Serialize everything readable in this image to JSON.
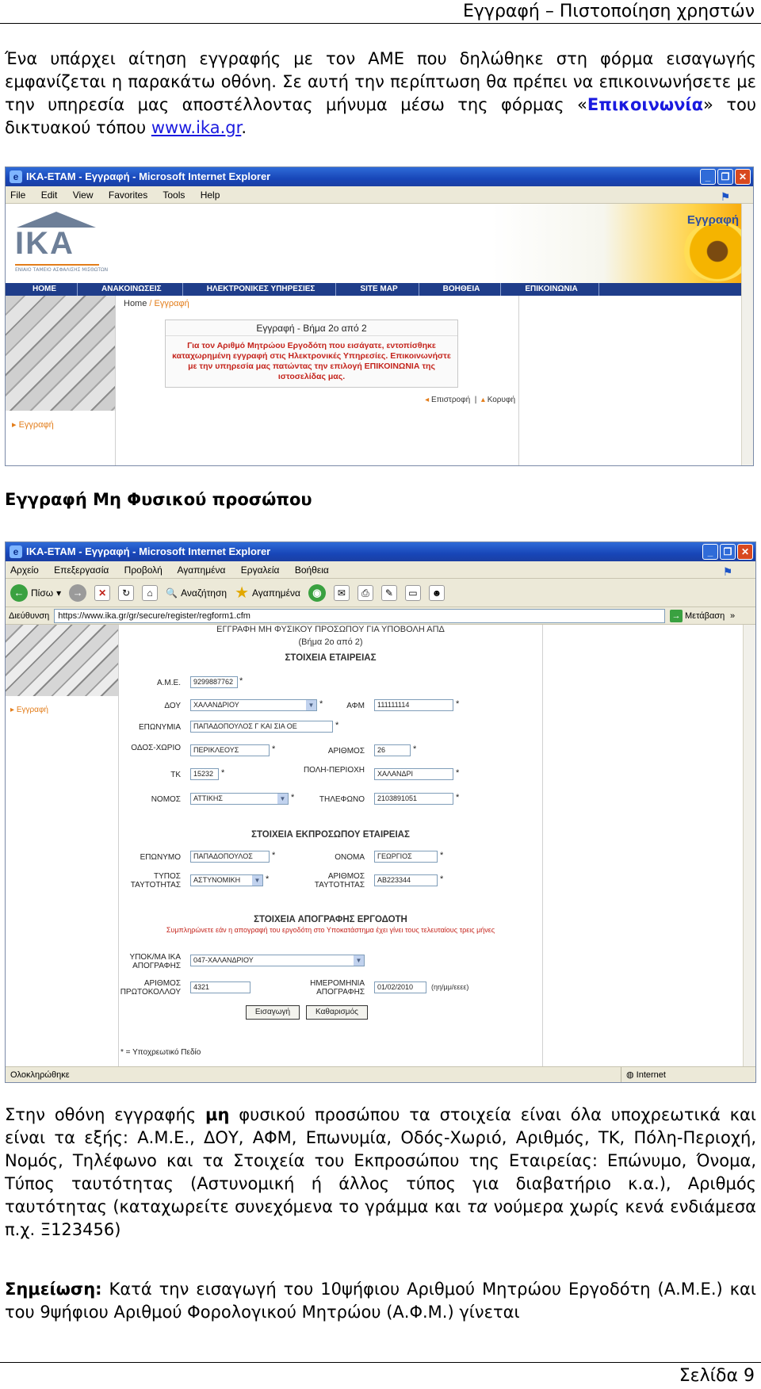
{
  "header": {
    "title": "Εγγραφή – Πιστοποίηση χρηστών"
  },
  "intro": {
    "text1": "Ένα υπάρχει αίτηση εγγραφής με τον ΑΜΕ που δηλώθηκε στη φόρμα εισαγωγής εμφανίζεται η παρακάτω οθόνη. Σε αυτή την περίπτωση θα πρέπει να επικοινωνήσετε με την υπηρεσία μας αποστέλλοντας μήνυμα μέσω της φόρμας «",
    "contact_link": "Επικοινωνία",
    "text2": "» του δικτυακού τόπου ",
    "site_link": "www.ika.gr",
    "text3": "."
  },
  "shot1": {
    "window_title": "IKA-ETAM - Εγγραφή - Microsoft Internet Explorer",
    "menu": [
      "File",
      "Edit",
      "View",
      "Favorites",
      "Tools",
      "Help"
    ],
    "logo_text": "IKA",
    "logo_small": "ΕΝΙΑΙΟ ΤΑΜΕΙΟ ΑΣΦΑΛΙΣΗΣ ΜΙΣΘΩΤΩΝ",
    "banner_label": "Εγγραφή",
    "nav": [
      "HOME",
      "ΑΝΑΚΟΙΝΩΣΕΙΣ",
      "ΗΛΕΚΤΡΟΝΙΚΕΣ ΥΠΗΡΕΣΙΕΣ",
      "SITE MAP",
      "ΒΟΗΘΕΙΑ",
      "ΕΠΙΚΟΙΝΩΝΙΑ"
    ],
    "crumb_home": "Home",
    "crumb_sep": "/",
    "crumb_current": "Εγγραφή",
    "step_title": "Εγγραφή - Βήμα 2ο από 2",
    "step_message": "Για τον Αριθμό Μητρώου Εργοδότη που εισάγατε, εντοπίσθηκε καταχωρημένη εγγραφή στις Ηλεκτρονικές Υπηρεσίες. Επικοινωνήστε με την υπηρεσία μας πατώντας την επιλογή ΕΠΙΚΟΙΝΩΝΙΑ της ιστοσελίδας μας.",
    "back_link": "Επιστροφή",
    "top_link": "Κορυφή",
    "side_link": "Εγγραφή"
  },
  "section_heading": "Εγγραφή Μη Φυσικού προσώπου",
  "shot2": {
    "window_title": "IKA-ETAM - Εγγραφή - Microsoft Internet Explorer",
    "menu": [
      "Αρχείο",
      "Επεξεργασία",
      "Προβολή",
      "Αγαπημένα",
      "Εργαλεία",
      "Βοήθεια"
    ],
    "toolbar": {
      "back": "Πίσω",
      "search": "Αναζήτηση",
      "favorites": "Αγαπημένα"
    },
    "address_label": "Διεύθυνση",
    "address": "https://www.ika.gr/gr/secure/register/regform1.cfm",
    "go_label": "Μετάβαση",
    "links_label": "»",
    "side_link": "Εγγραφή",
    "form": {
      "title1": "ΕΓΓΡΑΦΗ ΜΗ ΦΥΣΙΚΟΥ ΠΡΟΣΩΠΟΥ ΓΙΑ ΥΠΟΒΟΛΗ ΑΠΔ",
      "title2": "(Βήμα 2ο από 2)",
      "section_company": "ΣΤΟΙΧΕΙΑ ΕΤΑΙΡΕΙΑΣ",
      "ame_label": "Α.Μ.Ε.",
      "ame_value": "9299887762",
      "doy_label": "ΔΟΥ",
      "doy_value": "ΧΑΛΑΝΔΡΙΟΥ",
      "afm_label": "ΑΦΜ",
      "afm_value": "111111114",
      "name_label": "ΕΠΩΝΥΜΙΑ",
      "name_value": "ΠΑΠΑΔΟΠΟΥΛΟΣ Γ ΚΑΙ ΣΙΑ ΟΕ",
      "street_label": "ΟΔΟΣ-ΧΩΡΙΟ",
      "street_value": "ΠΕΡΙΚΛΕΟΥΣ",
      "number_label": "ΑΡΙΘΜΟΣ",
      "number_value": "26",
      "tk_label": "ΤΚ",
      "tk_value": "15232",
      "city_label": "ΠΟΛΗ-ΠΕΡΙΟΧΗ",
      "city_value": "ΧΑΛΑΝΔΡΙ",
      "nomos_label": "ΝΟΜΟΣ",
      "nomos_value": "ΑΤΤΙΚΗΣ",
      "phone_label": "ΤΗΛΕΦΩΝΟ",
      "phone_value": "2103891051",
      "section_rep": "ΣΤΟΙΧΕΙΑ ΕΚΠΡΟΣΩΠΟΥ ΕΤΑΙΡΕΙΑΣ",
      "surname_label": "ΕΠΩΝΥΜΟ",
      "surname_value": "ΠΑΠΑΔΟΠΟΥΛΟΣ",
      "firstname_label": "ΟΝΟΜΑ",
      "firstname_value": "ΓΕΩΡΓΙΟΣ",
      "idtype_label": "ΤΥΠΟΣ ΤΑΥΤΟΤΗΤΑΣ",
      "idtype_value": "ΑΣΤΥΝΟΜΙΚΗ",
      "idnum_label": "ΑΡΙΘΜΟΣ ΤΑΥΤΟΤΗΤΑΣ",
      "idnum_value": "ΑΒ223344",
      "section_census": "ΣΤΟΙΧΕΙΑ ΑΠΟΓΡΑΦΗΣ ΕΡΓΟΔΟΤΗ",
      "census_note": "Συμπληρώνετε εάν η απογραφή του εργοδότη στο Υποκατάστημα έχει γίνει τους τελευταίους τρεις μήνες",
      "branch_label": "ΥΠΟΚ/ΜΑ ΙΚΑ ΑΠΟΓΡΑΦΗΣ",
      "branch_value": "047-ΧΑΛΑΝΔΡΙΟΥ",
      "protocol_label": "ΑΡΙΘΜΟΣ ΠΡΩΤΟΚΟΛΛΟΥ",
      "protocol_value": "4321",
      "date_label": "ΗΜΕΡΟΜΗΝΙΑ ΑΠΟΓΡΑΦΗΣ",
      "date_value": "01/02/2010",
      "date_hint": "(ηη/μμ/εεεε)",
      "submit_label": "Εισαγωγή",
      "clear_label": "Καθαρισμός",
      "required_note": "* = Υποχρεωτικό Πεδίο"
    },
    "status_left": "Ολοκληρώθηκε",
    "status_zone": "Internet"
  },
  "para2": {
    "t1": "Στην οθόνη εγγραφής ",
    "bold": "μη",
    "t2": " φυσικού προσώπου τα στοιχεία είναι όλα υποχρεωτικά και είναι τα εξής: Α.Μ.Ε., ΔΟΥ, ΑΦΜ, Επωνυμία, Οδός-Χωριό, Αριθμός, ΤΚ, Πόλη-Περιοχή, Νομός, Τηλέφωνο και τα Στοιχεία του Εκπροσώπου της Εταιρείας: Επώνυμο, Όνομα, Τύπος ταυτότητας (Αστυνομική ή άλλος τύπος για διαβατήριο κ.α.), Αριθμός ταυτότητας (καταχωρείτε συνεχόμενα το γράμμα και ",
    "italic": "τα",
    "t3": " νούμερα χωρίς κενά ενδιάμεσα π.χ. Ξ123456)"
  },
  "note": {
    "label": "Σημείωση:",
    "text": " Κατά την εισαγωγή του 10ψήφιου Αριθμού Μητρώου Εργοδότη (Α.Μ.Ε.) και του 9ψήφιου Αριθμού Φορολογικού Μητρώου (Α.Φ.Μ.) γίνεται"
  },
  "footer": {
    "page": "Σελίδα 9"
  },
  "colors": {
    "link_blue": "#1a1adf",
    "ika_nav": "#1f3d8a",
    "ika_orange": "#e37d1a",
    "error_red": "#c4241c"
  }
}
